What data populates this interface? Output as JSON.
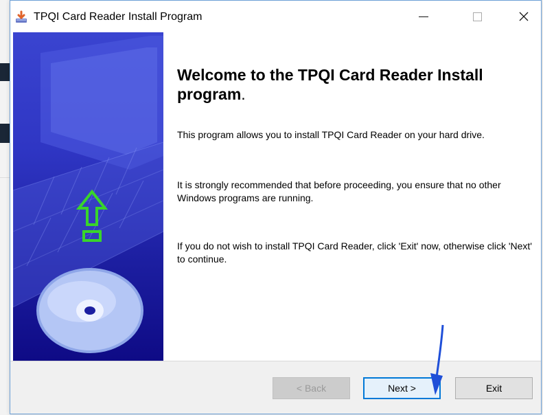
{
  "window": {
    "title": "TPQI Card Reader Install Program",
    "controls": {
      "minimize": "—",
      "close": "✕"
    }
  },
  "content": {
    "heading": "Welcome to the TPQI Card Reader Install program",
    "heading_period": ".",
    "paragraph1": "This program allows you to install TPQI Card Reader on your hard drive.",
    "paragraph2": "It is strongly recommended that before proceeding, you ensure that no other Windows programs are running.",
    "paragraph3": "If you do not wish to install TPQI Card Reader, click 'Exit' now, otherwise click 'Next' to continue."
  },
  "buttons": {
    "back": "< Back",
    "next": "Next >",
    "exit": "Exit"
  },
  "colors": {
    "accent": "#0078d7",
    "side_panel": "#2f36c4",
    "upload_arrow": "#39d52b"
  },
  "icons": {
    "app": "installer-icon",
    "side": "upload-arrow-icon",
    "disc": "cd-disc-icon"
  }
}
